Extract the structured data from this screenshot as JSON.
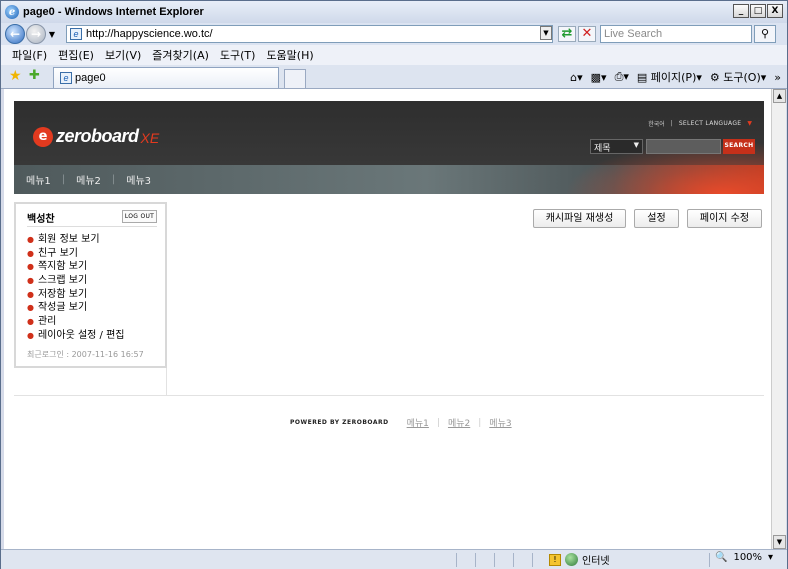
{
  "window": {
    "title": "page0 - Windows Internet Explorer",
    "min_label": "_",
    "max_label": "□",
    "close_label": "X"
  },
  "address": {
    "url": "http://happyscience.wo.tc/",
    "search_placeholder": "Live Search"
  },
  "menubar": {
    "items": [
      "파일(F)",
      "편집(E)",
      "보기(V)",
      "즐겨찾기(A)",
      "도구(T)",
      "도움말(H)"
    ]
  },
  "tabs": {
    "active_label": "page0",
    "commands": {
      "page": "페이지(P)",
      "tools": "도구(O)",
      "more": "»"
    }
  },
  "site": {
    "logo_word": "zeroboard",
    "logo_suffix": "XE",
    "lang_current": "한국어",
    "lang_select": "SELECT LANGUAGE",
    "search_option": "제목",
    "search_button": "SEARCH",
    "nav": [
      "메뉴1",
      "메뉴2",
      "메뉴3"
    ]
  },
  "login": {
    "user_name": "백성찬",
    "logout_label": "LOG OUT",
    "menu": [
      "회원 정보 보기",
      "친구 보기",
      "쪽지함 보기",
      "스크랩 보기",
      "저장함 보기",
      "작성글 보기",
      "관리",
      "레이아웃 설정 / 편집"
    ],
    "last_login_label": "최근로그인",
    "last_login_time": "2007-11-16 16:57"
  },
  "actions": {
    "regenerate_cache": "캐시파일 재생성",
    "settings": "설정",
    "edit_page": "페이지 수정"
  },
  "footer": {
    "powered": "POWERED BY ZEROBOARD",
    "links": [
      "메뉴1",
      "메뉴2",
      "메뉴3"
    ]
  },
  "statusbar": {
    "zone": "인터넷",
    "zoom": "100%"
  }
}
